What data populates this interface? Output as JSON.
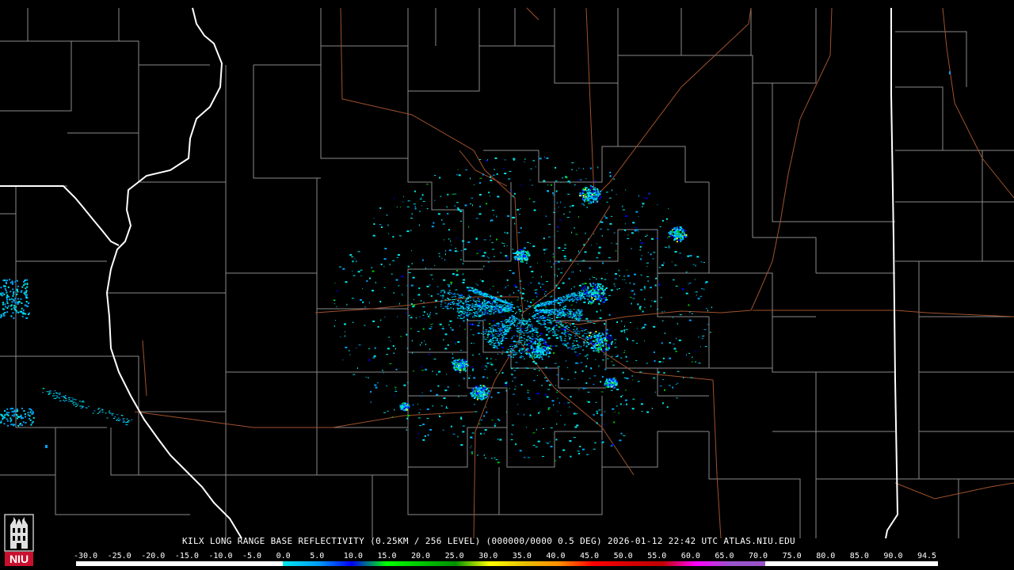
{
  "caption": {
    "station": "KILX",
    "product": "LONG RANGE BASE REFLECTIVITY",
    "resolution": "(0.25KM / 256 LEVEL)",
    "elevation": "(000000/0000 0.5 DEG)",
    "timestamp": "2026-01-12 22:42 UTC",
    "site": "ATLAS.NIU.EDU"
  },
  "logo": {
    "text": "NIU",
    "brand_color": "#c8102e"
  },
  "scale": {
    "labels": [
      "-30.0",
      "-25.0",
      "-20.0",
      "-15.0",
      "-10.0",
      "-5.0",
      "0.0",
      "5.0",
      "10.0",
      "15.0",
      "20.0",
      "25.0",
      "30.0",
      "35.0",
      "40.0",
      "45.0",
      "50.0",
      "55.0",
      "60.0",
      "65.0",
      "70.0",
      "75.0",
      "80.0",
      "85.0",
      "90.0",
      "94.5"
    ],
    "colors": [
      "#ffffff",
      "#ffffff",
      "#ffffff",
      "#ffffff",
      "#ffffff",
      "#ffffff",
      "#00e8ec",
      "#01a0f6",
      "#0000f6",
      "#00ff00",
      "#00c800",
      "#009000",
      "#ffff00",
      "#e7c000",
      "#ff9000",
      "#ff0000",
      "#d60000",
      "#c00000",
      "#ff00ff",
      "#9955c9",
      "#ffffff",
      "#ffffff",
      "#ffffff",
      "#ffffff",
      "#ffffff"
    ]
  },
  "map": {
    "background": "#000000",
    "county_color": "#8a8a8a",
    "state_color": "#ffffff",
    "highway_color": "#a0522d",
    "echo_colors": [
      "#00e8ec",
      "#01a0f6",
      "#0000f6",
      "#00c800",
      "#ffff00"
    ]
  }
}
